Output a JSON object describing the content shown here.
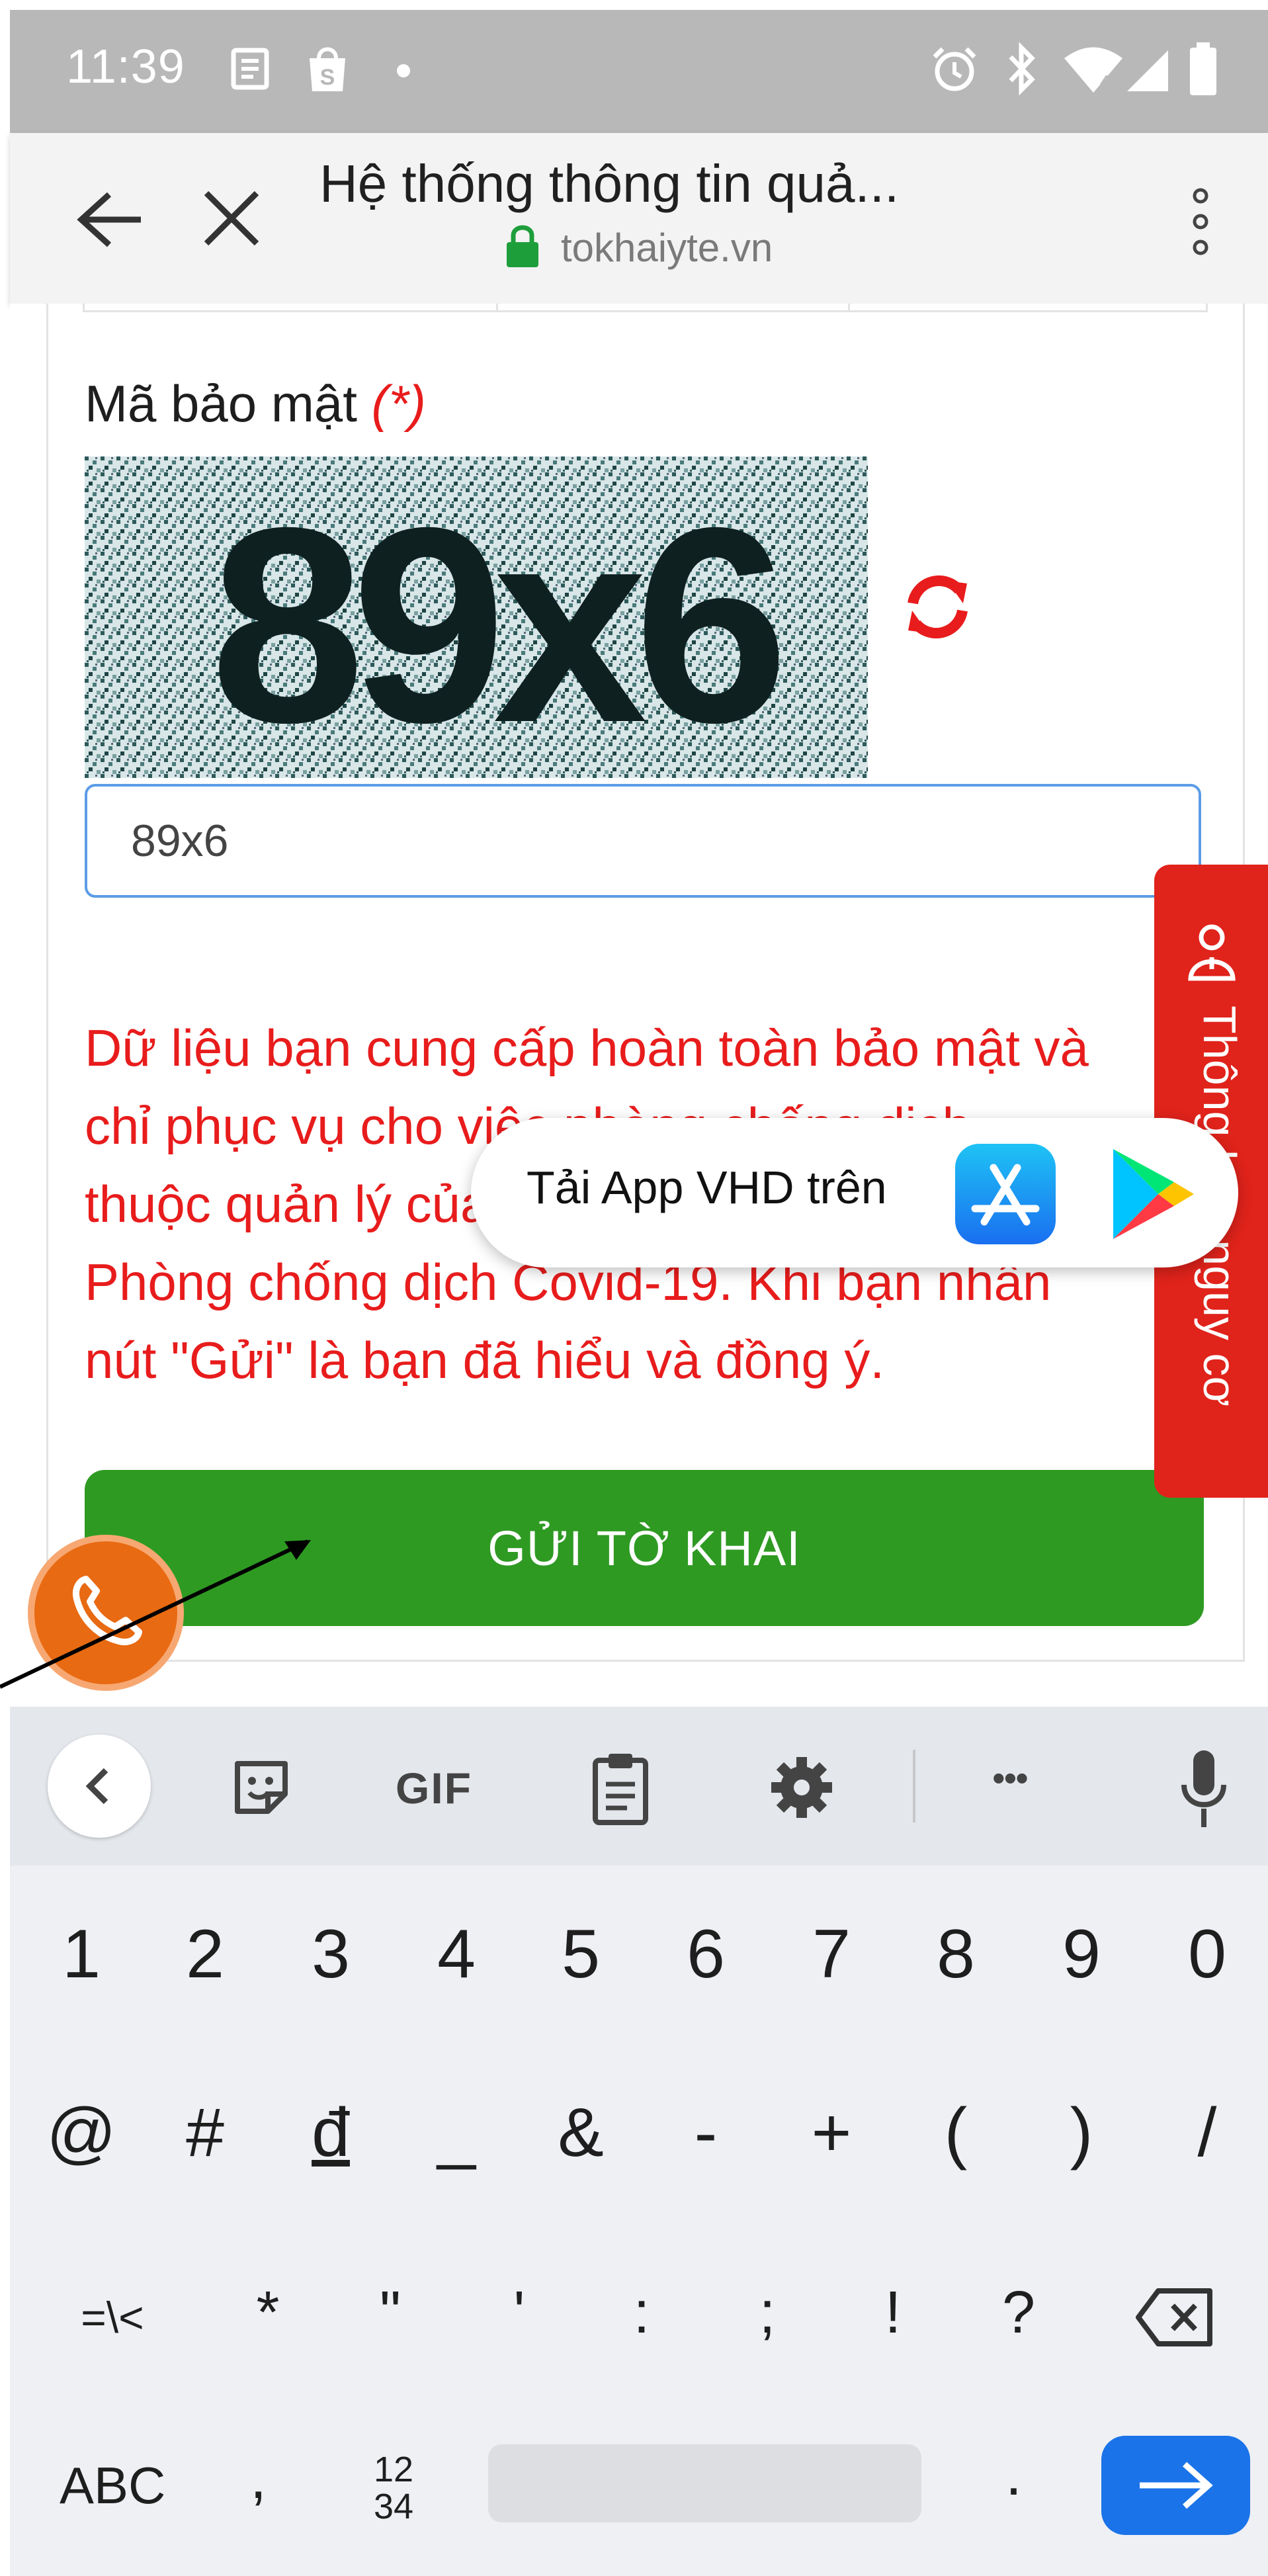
{
  "status_bar": {
    "time": "11:39",
    "icons": [
      "notes-icon",
      "shopping-bag-icon",
      "dot-icon",
      "alarm-icon",
      "bluetooth-icon",
      "wifi-icon",
      "signal-icon",
      "battery-icon"
    ]
  },
  "browser": {
    "title": "Hệ thống thông tin quả...",
    "url": "tokhaiyte.vn"
  },
  "form": {
    "captcha_label": "Mã bảo mật",
    "captcha_required": "(*)",
    "captcha_image_text": "89x6",
    "captcha_input_value": "89x6",
    "privacy_lines": [
      "Dữ liệu bạn cung cấp hoàn toàn bảo mật và",
      "chỉ phục vụ cho việc phòng chống dịch,",
      "thuộc quản lý của Ban chỉ đạo quốc gia về",
      "Phòng chống dịch Covid-19. Khi bạn nhấn",
      "nút \"Gửi\" là bạn đã hiểu và đồng ý."
    ],
    "submit_label": "GỬI TỜ KHAI"
  },
  "side_tab": {
    "label": "Thông báo nguy cơ"
  },
  "app_popup": {
    "text": "Tải App VHD trên"
  },
  "keyboard": {
    "toolbar": [
      "back-icon",
      "sticker-icon",
      "gif-icon",
      "clipboard-icon",
      "settings-icon",
      "more-icon",
      "mic-icon"
    ],
    "gif_label": "GIF",
    "more_label": "•••",
    "number_row": [
      "1",
      "2",
      "3",
      "4",
      "5",
      "6",
      "7",
      "8",
      "9",
      "0"
    ],
    "symbol_row": [
      "@",
      "#",
      "đ",
      "_",
      "&",
      "-",
      "+",
      "(",
      ")",
      "/"
    ],
    "symbol_row2": [
      "=\\<",
      "*",
      "\"",
      "'",
      ":",
      ";",
      "!",
      "?"
    ],
    "abc_label": "ABC",
    "comma_label": ",",
    "num_label_top": "12",
    "num_label_bottom": "34",
    "period_label": "."
  },
  "colors": {
    "status_bar_bg": "#b8b8b8",
    "accent_red": "#e81c1c",
    "submit_green": "#2e9a22",
    "enter_blue": "#1a73e8",
    "fab_orange": "#e86a12"
  }
}
